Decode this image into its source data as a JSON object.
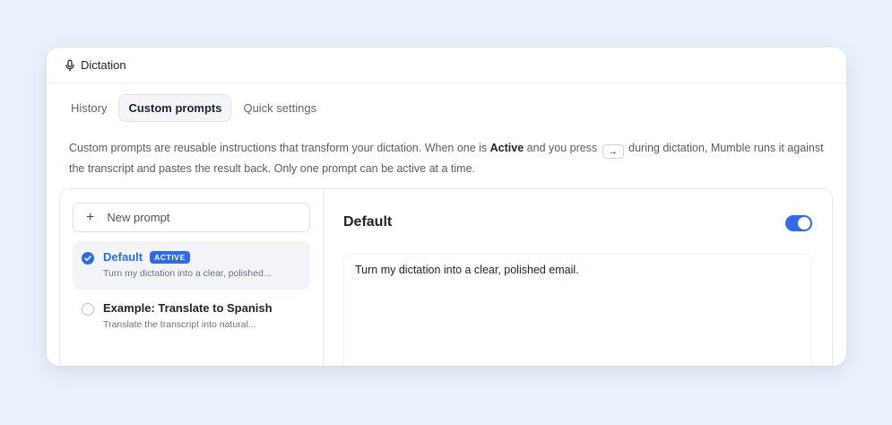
{
  "window": {
    "title": "Dictation",
    "title_icon": "microphone-icon"
  },
  "tabs": [
    {
      "label": "History",
      "active": false
    },
    {
      "label": "Custom prompts",
      "active": true
    },
    {
      "label": "Quick settings",
      "active": false
    }
  ],
  "description": {
    "part1": "Custom prompts are reusable instructions that transform your dictation. When one is ",
    "bold": "Active",
    "part2": " and you press ",
    "key": "→",
    "part3": " during dictation, Mumble runs it against the transcript and pastes the result back. Only one prompt can be active at a time."
  },
  "sidebar": {
    "new_prompt_label": "New prompt",
    "prompts": [
      {
        "name": "Default",
        "badge": "ACTIVE",
        "description": "Turn my dictation into a clear, polished...",
        "selected": true
      },
      {
        "name": "Example: Translate to Spanish",
        "badge": "",
        "description": "Translate the transcript into natural...",
        "selected": false
      }
    ]
  },
  "detail": {
    "title": "Default",
    "enabled": true,
    "prompt_text": "Turn my dictation into a clear, polished email."
  },
  "colors": {
    "accent": "#2e6be6",
    "background": "#eaf1fa"
  }
}
